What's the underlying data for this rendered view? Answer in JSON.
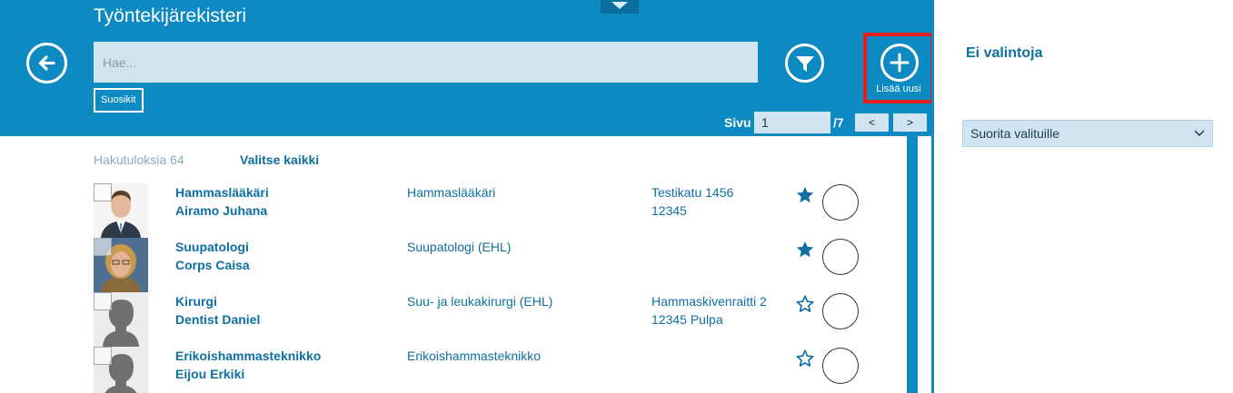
{
  "header": {
    "title": "Työntekijärekisteri",
    "search_placeholder": "Hae...",
    "favorites_label": "Suosikit",
    "add_label": "Lisää uusi"
  },
  "pager": {
    "label": "Sivu",
    "current": "1",
    "total": "/7",
    "prev": "<",
    "next": ">"
  },
  "results": {
    "count_text": "Hakutuloksia 64",
    "select_all": "Valitse kaikki",
    "rows": [
      {
        "title": "Hammaslääkäri",
        "name": "Airamo Juhana",
        "specialty": "Hammaslääkäri",
        "address1": "Testikatu 1456",
        "address2": "12345",
        "favorite": true,
        "avatar": "photo-man"
      },
      {
        "title": "Suupatologi",
        "name": "Corps Caisa",
        "specialty": "Suupatologi (EHL)",
        "address1": "",
        "address2": "",
        "favorite": true,
        "avatar": "photo-woman"
      },
      {
        "title": "Kirurgi",
        "name": "Dentist Daniel",
        "specialty": "Suu- ja leukakirurgi (EHL)",
        "address1": "Hammaskivenraitti 2",
        "address2": "12345 Pulpa",
        "favorite": false,
        "avatar": "placeholder-silhouette"
      },
      {
        "title": "Erikoishammasteknikko",
        "name": "Eijou Erkiki",
        "specialty": "Erikoishammasteknikko",
        "address1": "",
        "address2": "",
        "favorite": false,
        "avatar": "placeholder-silhouette"
      }
    ]
  },
  "side_panel": {
    "heading": "Ei valintoja",
    "action_dropdown": "Suorita valituille"
  },
  "colors": {
    "accent": "#0e8ac2",
    "link": "#0e6fa0",
    "highlight_border": "#e3201b",
    "input_bg": "#cfe6f2"
  }
}
